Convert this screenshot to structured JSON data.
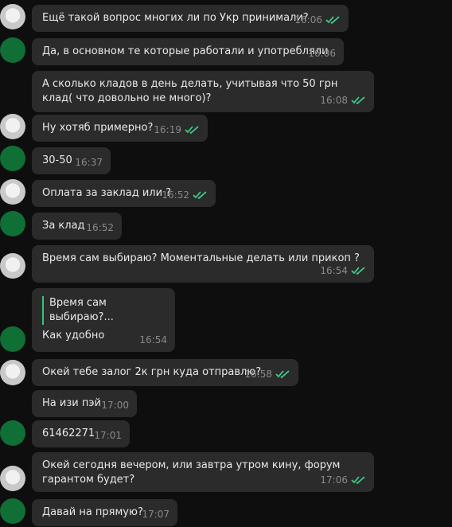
{
  "colors": {
    "background": "#0e0e0e",
    "bubble": "#2b2b2b",
    "check": "#3fd08a",
    "quote_bar": "#39c27a"
  },
  "messages": [
    {
      "text": "Ещё такой вопрос многих ли по Укр принимали?",
      "time": "16:06",
      "read": true,
      "avatar": "cat-avatar"
    },
    {
      "text": "Да, в основном те которые работали и употребляли",
      "time": "16:06",
      "read": false,
      "avatar": "party-home-avatar"
    },
    {
      "text": "А сколько кладов в день делать, учитывая что 50 грн клад( что довольно не много)?",
      "time": "16:08",
      "read": true,
      "avatar": ""
    },
    {
      "text": "Ну хотяб примерно?",
      "time": "16:19",
      "read": true,
      "avatar": "cat-avatar"
    },
    {
      "text": "30-50",
      "time": "16:37",
      "read": false,
      "avatar": "party-home-avatar"
    },
    {
      "text": "Оплата за заклад или ?",
      "time": "16:52",
      "read": true,
      "avatar": "cat-avatar"
    },
    {
      "text": "За клад",
      "time": "16:52",
      "read": false,
      "avatar": "party-home-avatar"
    },
    {
      "text": "Время сам выбираю? Моментальные делать или прикоп ?",
      "time": "16:54",
      "read": true,
      "avatar": "cat-avatar"
    },
    {
      "quote": "Время сам выбираю?...",
      "text": "Как удобно",
      "time": "16:54",
      "read": false,
      "avatar": "party-home-avatar"
    },
    {
      "text": "Окей тебе залог 2к грн куда отправлю?",
      "time": "16:58",
      "read": true,
      "avatar": "cat-avatar"
    },
    {
      "text": "На изи пэй",
      "time": "17:00",
      "read": false,
      "avatar": ""
    },
    {
      "text": "61462271",
      "time": "17:01",
      "read": false,
      "avatar": "party-home-avatar"
    },
    {
      "text": "Окей сегодня вечером, или завтра утром кину, форум гарантом будет?",
      "time": "17:06",
      "read": true,
      "avatar": "cat-avatar"
    },
    {
      "text": "Давай на прямую?",
      "time": "17:07",
      "read": false,
      "avatar": "party-home-avatar"
    }
  ]
}
